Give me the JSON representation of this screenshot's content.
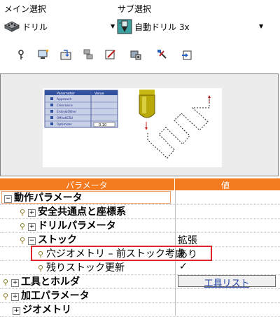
{
  "main_select": {
    "label": "メイン選択",
    "value": "ドリル",
    "icon": "drill-block-icon"
  },
  "sub_select": {
    "label": "サブ選択",
    "value": "自動ドリル 3x",
    "icon": "auto-drill-icon"
  },
  "toolbar": {
    "icons": [
      "key-icon",
      "computer-icon",
      "import-icon",
      "network-icon",
      "edit-icon",
      "settings-icon",
      "tool-icon",
      "export-icon"
    ]
  },
  "preview": {
    "table_headers": [
      "Parameter",
      "Value"
    ],
    "table_rows": [
      "Approach",
      "Clearance",
      "Entry&Other",
      "Offset&Tol",
      "Optimizer"
    ],
    "optimizer_value": "0.10"
  },
  "grid": {
    "header_param": "パラメータ",
    "header_value": "値",
    "accent_color": "#f47a20",
    "highlight_color": "#e0242b",
    "rows": [
      {
        "name": "動作パラメータ",
        "value": ""
      },
      {
        "name": "安全共通点と座標系",
        "value": ""
      },
      {
        "name": "ドリルパラメータ",
        "value": ""
      },
      {
        "name": "ストック",
        "value": "拡張"
      },
      {
        "name": "穴ジオメトリ – 前ストック考慮",
        "value": "あり"
      },
      {
        "name": "残りストック更新",
        "value": "✓"
      },
      {
        "name": "工具とホルダ",
        "value": "工具リスト"
      },
      {
        "name": "加工パラメータ",
        "value": ""
      },
      {
        "name": "ジオメトリ",
        "value": ""
      }
    ]
  }
}
